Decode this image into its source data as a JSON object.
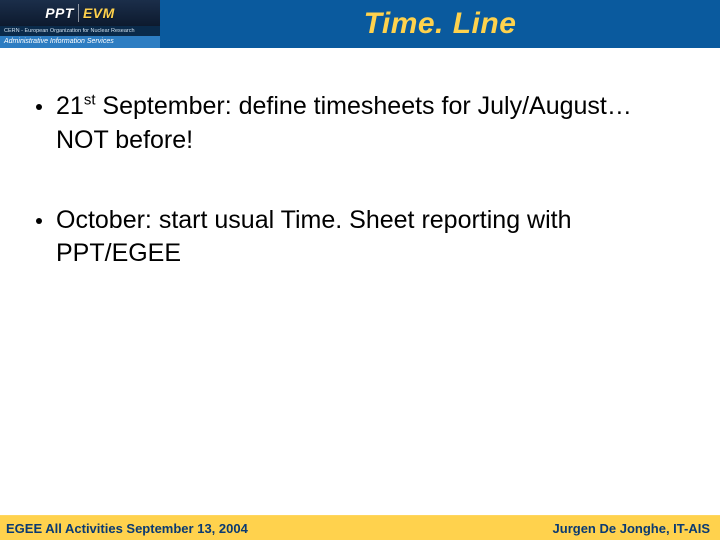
{
  "colors": {
    "header_bg": "#0a5a9e",
    "title_color": "#ffd24d",
    "footer_bg": "#ffd24d",
    "footer_text": "#0a3a72"
  },
  "header": {
    "logo": {
      "ppt": "PPT",
      "evm": "EVM",
      "cern_line": "CERN - European Organization for Nuclear Research",
      "admin_line": "Administrative Information Services"
    },
    "title": "Time. Line"
  },
  "bullets": [
    {
      "ordinal_number": "21",
      "ordinal_suffix": "st",
      "rest": " September: define timesheets for July/August… NOT before!"
    },
    {
      "text": "October: start usual Time. Sheet reporting with PPT/EGEE"
    }
  ],
  "footer": {
    "left": "EGEE All Activities  September 13, 2004",
    "right": "Jurgen De Jonghe, IT-AIS"
  }
}
